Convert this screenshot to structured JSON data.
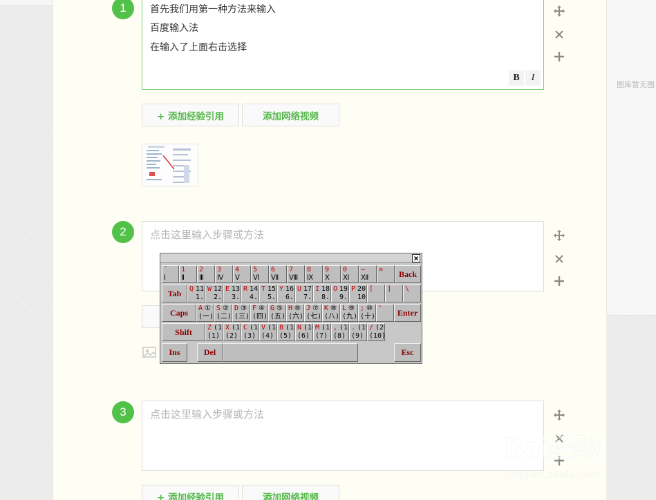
{
  "gallery": {
    "empty_text": "图库暂无图"
  },
  "steps": [
    {
      "number": "1",
      "lines": [
        "首先我们用第一种方法来输入",
        "百度输入法",
        "在输入了上面右击选择"
      ],
      "bold_label": "B",
      "italic_label": "I"
    },
    {
      "number": "2",
      "placeholder": "点击这里输入步骤或方法"
    },
    {
      "number": "3",
      "placeholder": "点击这里输入步骤或方法"
    }
  ],
  "actions": {
    "add_reference": "+ 添加经验引用",
    "add_video": "添加网络视频"
  },
  "keyboard": {
    "close": "×",
    "row1": [
      {
        "top": "`",
        "bottom": "Ⅰ"
      },
      {
        "top": "1",
        "bottom": "Ⅱ"
      },
      {
        "top": "2",
        "bottom": "Ⅲ"
      },
      {
        "top": "3",
        "bottom": "Ⅳ"
      },
      {
        "top": "4",
        "bottom": "Ⅴ"
      },
      {
        "top": "5",
        "bottom": "Ⅵ"
      },
      {
        "top": "6",
        "bottom": "Ⅶ"
      },
      {
        "top": "7",
        "bottom": "Ⅷ"
      },
      {
        "top": "8",
        "bottom": "Ⅸ"
      },
      {
        "top": "9",
        "bottom": "Ⅹ"
      },
      {
        "top": "0",
        "bottom": "Ⅺ"
      },
      {
        "top": "–",
        "bottom": "Ⅻ"
      },
      {
        "top": "=",
        "bottom": ""
      }
    ],
    "row2": [
      {
        "top": "Q",
        "r1": "11.",
        "r2": "1."
      },
      {
        "top": "W",
        "r1": "12.",
        "r2": "2."
      },
      {
        "top": "E",
        "r1": "13.",
        "r2": "3."
      },
      {
        "top": "R",
        "r1": "14.",
        "r2": "4."
      },
      {
        "top": "T",
        "r1": "15.",
        "r2": "5."
      },
      {
        "top": "Y",
        "r1": "16.",
        "r2": "6."
      },
      {
        "top": "U",
        "r1": "17.",
        "r2": "7."
      },
      {
        "top": "I",
        "r1": "18.",
        "r2": "8."
      },
      {
        "top": "O",
        "r1": "19.",
        "r2": "9."
      },
      {
        "top": "P",
        "r1": "20.",
        "r2": "10."
      },
      {
        "top": "[",
        "r1": "",
        "r2": ""
      },
      {
        "top": "]",
        "r1": "",
        "r2": ""
      },
      {
        "top": "\\",
        "r1": "",
        "r2": ""
      }
    ],
    "row3": [
      {
        "top": "A",
        "r1": "①",
        "r2": "(一)"
      },
      {
        "top": "S",
        "r1": "②",
        "r2": "(二)"
      },
      {
        "top": "D",
        "r1": "③",
        "r2": "(三)"
      },
      {
        "top": "F",
        "r1": "④",
        "r2": "(四)"
      },
      {
        "top": "G",
        "r1": "⑤",
        "r2": "(五)"
      },
      {
        "top": "H",
        "r1": "⑥",
        "r2": "(六)"
      },
      {
        "top": "J",
        "r1": "⑦",
        "r2": "(七)"
      },
      {
        "top": "K",
        "r1": "⑧",
        "r2": "(八)"
      },
      {
        "top": "L",
        "r1": "⑨",
        "r2": "(九)"
      },
      {
        "top": ";",
        "r1": "⑩",
        "r2": "(十)"
      },
      {
        "top": "'",
        "r1": "",
        "r2": ""
      }
    ],
    "row4": [
      {
        "top": "Z",
        "r1": "(1)",
        "r2": "(1)"
      },
      {
        "top": "X",
        "r1": "(12)",
        "r2": "(2)"
      },
      {
        "top": "C",
        "r1": "(13)",
        "r2": "(3)"
      },
      {
        "top": "V",
        "r1": "(14)",
        "r2": "(4)"
      },
      {
        "top": "B",
        "r1": "(15)",
        "r2": "(5)"
      },
      {
        "top": "N",
        "r1": "(16)",
        "r2": "(6)"
      },
      {
        "top": "M",
        "r1": "(17)",
        "r2": "(7)"
      },
      {
        "top": ",",
        "r1": "(18)",
        "r2": "(8)"
      },
      {
        "top": ".",
        "r1": "(19)",
        "r2": "(9)"
      },
      {
        "top": "/",
        "r1": "(20)",
        "r2": "(10)"
      }
    ],
    "func": {
      "back": "Back",
      "tab": "Tab",
      "caps": "Caps",
      "enter": "Enter",
      "shift": "Shift",
      "ins": "Ins",
      "del": "Del",
      "esc": "Esc"
    }
  },
  "watermark": {
    "logo": "Bai经验",
    "domain": "jingyan.baidu.com"
  }
}
